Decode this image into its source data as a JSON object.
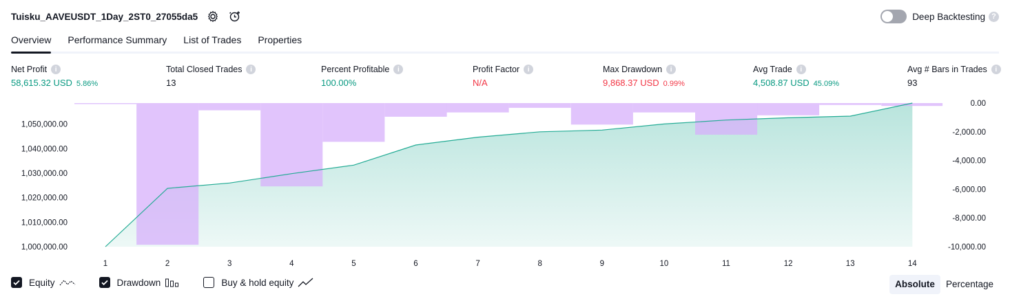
{
  "header": {
    "title": "Tuisku_AAVEUSDT_1Day_2ST0_27055da5",
    "deep_backtesting_label": "Deep Backtesting",
    "deep_backtesting_enabled": false,
    "help_mark": "?"
  },
  "tabs": [
    {
      "label": "Overview",
      "active": true
    },
    {
      "label": "Performance Summary",
      "active": false
    },
    {
      "label": "List of Trades",
      "active": false
    },
    {
      "label": "Properties",
      "active": false
    }
  ],
  "info_mark": "i",
  "metrics": {
    "net_profit": {
      "label": "Net Profit",
      "value": "58,615.32 USD",
      "pct": "5.86%"
    },
    "total_closed_trades": {
      "label": "Total Closed Trades",
      "value": "13"
    },
    "percent_profitable": {
      "label": "Percent Profitable",
      "value": "100.00%"
    },
    "profit_factor": {
      "label": "Profit Factor",
      "value": "N/A"
    },
    "max_drawdown": {
      "label": "Max Drawdown",
      "value": "9,868.37 USD",
      "pct": "0.99%"
    },
    "avg_trade": {
      "label": "Avg Trade",
      "value": "4,508.87 USD",
      "pct": "45.09%"
    },
    "avg_bars": {
      "label": "Avg # Bars in Trades",
      "value": "93"
    }
  },
  "colors": {
    "equity_line": "#22ab94",
    "equity_fill": "#22ab94",
    "drawdown_bar": "#d7b0fb",
    "positive": "#089981",
    "negative": "#f23645"
  },
  "chart_data": {
    "type": "line+bar",
    "x": [
      1,
      2,
      3,
      4,
      5,
      6,
      7,
      8,
      9,
      10,
      11,
      12,
      13,
      14
    ],
    "series": [
      {
        "name": "Equity",
        "axis": "left",
        "values": [
          1000000,
          1023800,
          1026000,
          1029800,
          1033300,
          1041500,
          1044700,
          1046900,
          1047600,
          1050100,
          1051700,
          1052600,
          1053300,
          1058615
        ]
      },
      {
        "name": "Drawdown",
        "axis": "right",
        "values": [
          -30,
          -9868,
          -500,
          -5800,
          -2700,
          -950,
          -650,
          -330,
          -1500,
          -650,
          -2200,
          -850,
          -130,
          -200
        ]
      }
    ],
    "left_ticks": [
      "1,000,000.00",
      "1,010,000.00",
      "1,020,000.00",
      "1,030,000.00",
      "1,040,000.00",
      "1,050,000.00"
    ],
    "left_tick_values": [
      1000000,
      1010000,
      1020000,
      1030000,
      1040000,
      1050000
    ],
    "right_ticks": [
      "0.00",
      "-2,000.00",
      "-4,000.00",
      "-6,000.00",
      "-8,000.00",
      "-10,000.00"
    ],
    "right_tick_values": [
      0,
      -2000,
      -4000,
      -6000,
      -8000,
      -10000
    ],
    "x_ticks": [
      "1",
      "2",
      "3",
      "4",
      "5",
      "6",
      "7",
      "8",
      "9",
      "10",
      "11",
      "12",
      "13",
      "14"
    ],
    "left_range": [
      1000000,
      1058615
    ],
    "right_range": [
      -10000,
      0
    ]
  },
  "legend": {
    "equity": {
      "label": "Equity",
      "checked": true
    },
    "drawdown": {
      "label": "Drawdown",
      "checked": true
    },
    "buy_hold": {
      "label": "Buy & hold equity",
      "checked": false
    }
  },
  "mode": {
    "absolute": "Absolute",
    "percentage": "Percentage",
    "selected": "absolute"
  }
}
